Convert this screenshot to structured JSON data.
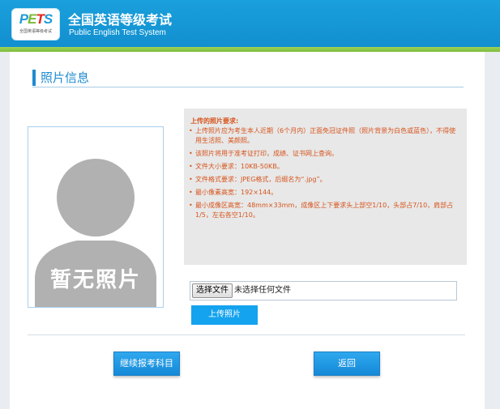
{
  "header": {
    "logo": {
      "p": "P",
      "e": "E",
      "t": "T",
      "s": "S",
      "sub": "全国英语等级考试"
    },
    "title_cn": "全国英语等级考试",
    "title_en": "Public English Test System"
  },
  "section": {
    "title": "照片信息"
  },
  "photo": {
    "placeholder": "暂无照片"
  },
  "requirements": {
    "title": "上传的照片要求:",
    "items": [
      "上传照片应为考生本人近期（6个月内）正面免冠证件照（照片背景为白色或蓝色），不得使用生活照、美颜照。",
      "该照片将用于准考证打印，成绩、证书网上查询。",
      "文件大小要求：10KB-50KB。",
      "文件格式要求：JPEG格式，后缀名为“.jpg”。",
      "最小像素高宽：192×144。",
      "最小成像区高宽：48mm×33mm，成像区上下要求头上部空1/10，头部占7/10，肩部占1/5，左右各空1/10。"
    ]
  },
  "file_input": {
    "button_label": "选择文件",
    "status": "未选择任何文件"
  },
  "upload_button": "上传照片",
  "actions": {
    "continue_label": "继续报考科目",
    "back_label": "返回"
  },
  "colors": {
    "header_blue": "#128fd0",
    "accent_green": "#7cbd3a",
    "req_text": "#d6541c",
    "button_blue": "#14a3ee"
  }
}
